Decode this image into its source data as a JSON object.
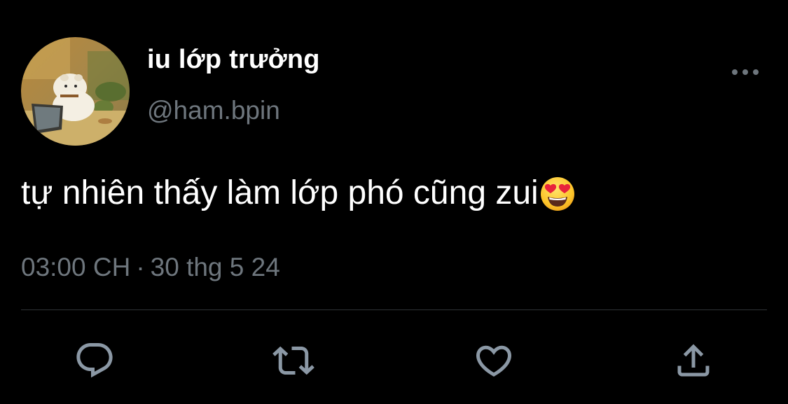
{
  "tweet": {
    "author": {
      "display_name": "iu lớp trưởng",
      "handle": "@ham.bpin",
      "avatar_icon": "hamster-avatar"
    },
    "more_icon": "more-horizontal-icon",
    "text": "tự nhiên thấy làm lớp phó cũng zui",
    "emoji": "smiling-face-with-heart-eyes",
    "time": "03:00 CH",
    "separator": "·",
    "date": "30 thg 5 24",
    "actions": [
      {
        "icon": "reply-icon"
      },
      {
        "icon": "retweet-icon"
      },
      {
        "icon": "like-icon"
      },
      {
        "icon": "share-icon"
      }
    ]
  },
  "colors": {
    "background": "#000000",
    "primary_text": "#ffffff",
    "secondary_text": "#6e767d",
    "divider": "#2f3336"
  }
}
